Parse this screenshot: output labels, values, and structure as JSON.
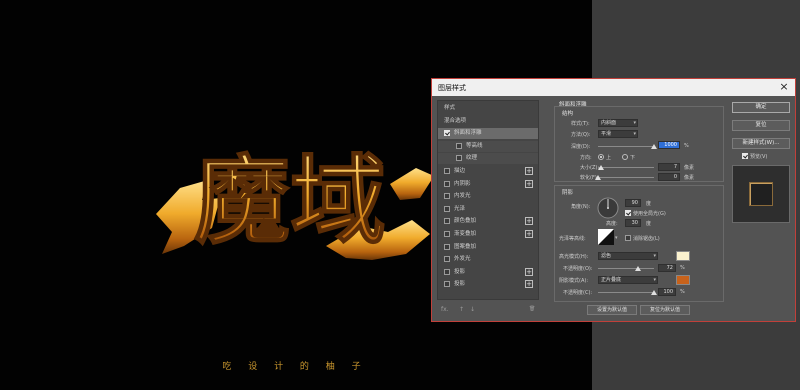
{
  "dialog": {
    "title": "图层样式",
    "close_label": "×"
  },
  "style_list": {
    "items": [
      {
        "label": "样式",
        "checkbox": false,
        "checked": false,
        "plus": false,
        "state": ""
      },
      {
        "label": "混合选项",
        "checkbox": false,
        "checked": false,
        "plus": false,
        "state": ""
      },
      {
        "label": "斜面和浮雕",
        "checkbox": true,
        "checked": true,
        "plus": false,
        "state": "selected"
      },
      {
        "label": "等高线",
        "checkbox": true,
        "checked": false,
        "plus": false,
        "state": "sub"
      },
      {
        "label": "纹理",
        "checkbox": true,
        "checked": false,
        "plus": false,
        "state": "sub"
      },
      {
        "label": "描边",
        "checkbox": true,
        "checked": false,
        "plus": true,
        "state": ""
      },
      {
        "label": "内阴影",
        "checkbox": true,
        "checked": false,
        "plus": true,
        "state": ""
      },
      {
        "label": "内发光",
        "checkbox": true,
        "checked": false,
        "plus": false,
        "state": ""
      },
      {
        "label": "光泽",
        "checkbox": true,
        "checked": false,
        "plus": false,
        "state": ""
      },
      {
        "label": "颜色叠加",
        "checkbox": true,
        "checked": false,
        "plus": true,
        "state": ""
      },
      {
        "label": "渐变叠加",
        "checkbox": true,
        "checked": false,
        "plus": true,
        "state": ""
      },
      {
        "label": "图案叠加",
        "checkbox": true,
        "checked": false,
        "plus": false,
        "state": ""
      },
      {
        "label": "外发光",
        "checkbox": true,
        "checked": false,
        "plus": false,
        "state": ""
      },
      {
        "label": "投影",
        "checkbox": true,
        "checked": false,
        "plus": true,
        "state": ""
      },
      {
        "label": "投影",
        "checkbox": true,
        "checked": false,
        "plus": true,
        "state": ""
      }
    ],
    "footer": {
      "fx": "fx.",
      "up": "↑",
      "down": "↓",
      "trash": "🗑"
    }
  },
  "bevel": {
    "section_title": "斜面和浮雕",
    "structure_title": "结构",
    "style_label": "样式(T):",
    "style_value": "内斜面",
    "technique_label": "方法(Q):",
    "technique_value": "平滑",
    "depth_label": "深度(D):",
    "depth_value": "1000",
    "depth_unit": "%",
    "depth_level": 1.0,
    "direction_label": "方向:",
    "direction_up": "上",
    "direction_down": "下",
    "size_label": "大小(Z):",
    "size_value": "7",
    "size_unit": "像素",
    "size_level": 0.05,
    "soften_label": "软化(F):",
    "soften_value": "0",
    "soften_unit": "像素",
    "soften_level": 0.0
  },
  "shading": {
    "title": "阴影",
    "angle_label": "角度(N):",
    "angle_value": "90",
    "angle_unit": "度",
    "global_light_label": "使用全局光(G)",
    "altitude_label": "高度:",
    "altitude_value": "30",
    "altitude_unit": "度",
    "gloss_contour_label": "光泽等高线:",
    "anti_alias_label": "消除锯齿(L)",
    "highlight_mode_label": "高光模式(H):",
    "highlight_mode_value": "滤色",
    "highlight_color": "#fbf2cf",
    "highlight_opacity_label": "不透明度(O):",
    "highlight_opacity_value": "72",
    "highlight_opacity_unit": "%",
    "highlight_opacity_level": 0.72,
    "shadow_mode_label": "阴影模式(A):",
    "shadow_mode_value": "正片叠底",
    "shadow_color": "#c7621b",
    "shadow_opacity_label": "不透明度(C):",
    "shadow_opacity_value": "100",
    "shadow_opacity_unit": "%",
    "shadow_opacity_level": 1.0
  },
  "bottom_buttons": {
    "make_default": "设置为默认值",
    "reset_default": "复位为默认值"
  },
  "right_buttons": {
    "ok": "确定",
    "reset": "复位",
    "new_style": "新建样式(W)...",
    "preview_label": "预览(V)"
  },
  "artwork": {
    "text": "魔域",
    "caption": "吃 设 计 的 柚 子",
    "colors": {
      "gold": "#e8a42a",
      "gold_light": "#ffd878",
      "caption": "#c9962e"
    }
  }
}
